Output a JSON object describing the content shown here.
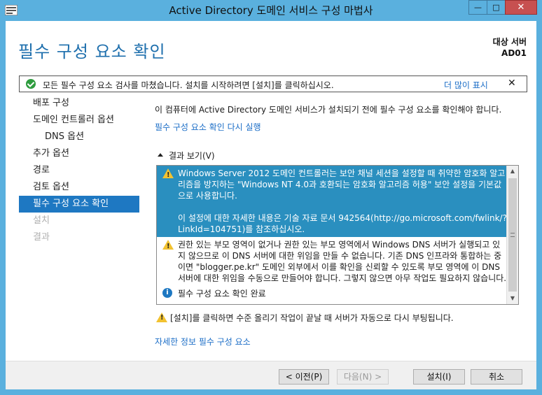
{
  "window": {
    "title": "Active Directory 도메인 서비스 구성 마법사",
    "close_glyph": "✕",
    "minimize_glyph": "—",
    "maximize_glyph": "□"
  },
  "header": {
    "page_title": "필수 구성 요소 확인",
    "target_label": "대상 서버",
    "target_server": "AD01"
  },
  "notice": {
    "message": "모든 필수 구성 요소 검사를 마쳤습니다. 설치를 시작하려면 [설치]를 클릭하십시오.",
    "more_link": "더 많이 표시",
    "dismiss": "✕"
  },
  "nav": {
    "items": [
      {
        "label": "배포 구성"
      },
      {
        "label": "도메인 컨트롤러 옵션"
      },
      {
        "label": "DNS 옵션"
      },
      {
        "label": "추가 옵션"
      },
      {
        "label": "경로"
      },
      {
        "label": "검토 옵션"
      },
      {
        "label": "필수 구성 요소 확인"
      },
      {
        "label": "설치"
      },
      {
        "label": "결과"
      }
    ]
  },
  "content": {
    "intro": "이 컴퓨터에 Active Directory 도메인 서비스가 설치되기 전에 필수 구성 요소를 확인해야 합니다.",
    "rerun_link": "필수 구성 요소 확인 다시 실행",
    "results_toggle": "결과 보기(V)",
    "results": [
      {
        "text": "Windows Server 2012 도메인 컨트롤러는 보안 채널 세션을 설정할 때 취약한 암호화 알고리즘을 방지하는 \"Windows NT 4.0과 호환되는 암호화 알고리즘 허용\" 보안 설정을 기본값으로 사용합니다.",
        "text2": "이 설정에 대한 자세한 내용은 기술 자료 문서 942564(http://go.microsoft.com/fwlink/?LinkId=104751)를 참조하십시오."
      },
      {
        "text": "권한 있는 부모 영역이 없거나 권한 있는 부모 영역에서 Windows DNS 서버가 실행되고 있지 않으므로 이 DNS 서버에 대한 위임을 만들 수 없습니다. 기존 DNS 인프라와 통합하는 중이면 \"blogger.pe.kr\" 도메인 외부에서 이를 확인을 신뢰할 수 있도록 부모 영역에 이 DNS 서버에 대한 위임을 수동으로 만들어야 합니다. 그렇지 않으면 아무 작업도 필요하지 않습니다."
      },
      {
        "text": "필수 구성 요소 확인 완료"
      }
    ],
    "reboot_note": "[설치]를 클릭하면 수준 올리기 작업이 끝날 때 서버가 자동으로 다시 부팅됩니다.",
    "details_link": "자세한 정보 필수 구성 요소"
  },
  "footer": {
    "prev": "< 이전(P)",
    "next": "다음(N) >",
    "install": "설치(I)",
    "cancel": "취소"
  },
  "colors": {
    "title_bar": "#5ab0de",
    "page_title": "#1e6fad",
    "nav_active": "#1e78c2",
    "selected_result": "#2a8fbf",
    "link": "#1c6ec7",
    "warning": "#f2c230",
    "success": "#2e9c3e"
  }
}
